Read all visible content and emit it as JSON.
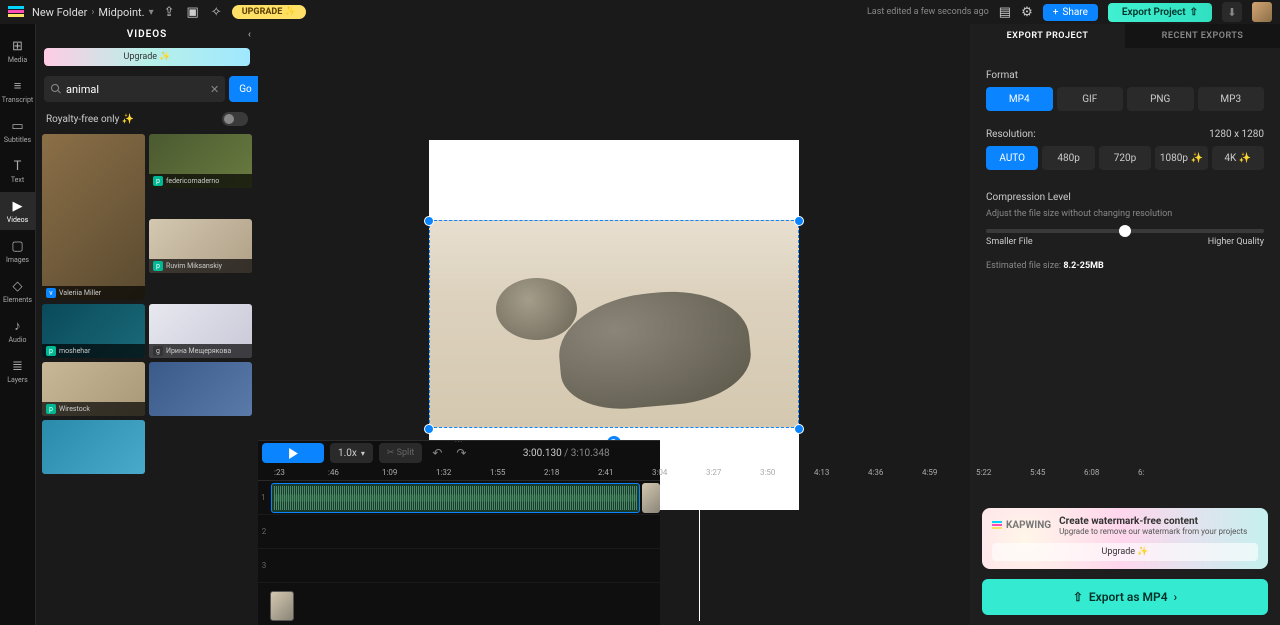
{
  "topbar": {
    "folder": "New Folder",
    "project": "Midpoint.",
    "upgrade": "UPGRADE ✨",
    "edited": "Last edited a few seconds ago",
    "share": "Share",
    "export": "Export Project"
  },
  "rail": {
    "media": "Media",
    "transcript": "Transcript",
    "subtitles": "Subtitles",
    "text": "Text",
    "videos": "Videos",
    "images": "Images",
    "elements": "Elements",
    "audio": "Audio",
    "layers": "Layers"
  },
  "mediaPanel": {
    "title": "VIDEOS",
    "upgrade": "Upgrade ✨",
    "searchValue": "animal",
    "go": "Go",
    "royalty": "Royalty-free only ✨",
    "authors": {
      "a0": "Valeriia Miller",
      "a1": "federicomaderno",
      "a2": "Ruvim Miksanskiy",
      "a3": "moshehar",
      "a4": "Ирина Мещерякова",
      "a5": "Wirestock"
    }
  },
  "timeline": {
    "speed": "1.0x",
    "split": "✂ Split",
    "current": "3:00.130",
    "total": "3:10.348",
    "marks": [
      ":23",
      ":46",
      "1:09",
      "1:32",
      "1:55",
      "2:18",
      "2:41",
      "3:04",
      "3:27",
      "3:50",
      "4:13",
      "4:36",
      "4:59",
      "5:22",
      "5:45",
      "6:08",
      "6:"
    ]
  },
  "export": {
    "tab1": "EXPORT PROJECT",
    "tab2": "RECENT EXPORTS",
    "formatLabel": "Format",
    "formats": {
      "mp4": "MP4",
      "gif": "GIF",
      "png": "PNG",
      "mp3": "MP3"
    },
    "resolutionLabel": "Resolution:",
    "resolutionValue": "1280 x 1280",
    "res": {
      "auto": "AUTO",
      "r480": "480p",
      "r720": "720p",
      "r1080": "1080p ✨",
      "r4k": "4K ✨"
    },
    "compressionLabel": "Compression Level",
    "compressionSub": "Adjust the file size without changing resolution",
    "smaller": "Smaller File",
    "higher": "Higher Quality",
    "estLabel": "Estimated file size: ",
    "estValue": "8.2-25MB",
    "wmBrand": "KAPWING",
    "wmTitle": "Create watermark-free content",
    "wmSub": "Upgrade to remove our watermark from your projects",
    "wmBtn": "Upgrade ✨",
    "exportBtn": "Export as MP4"
  }
}
